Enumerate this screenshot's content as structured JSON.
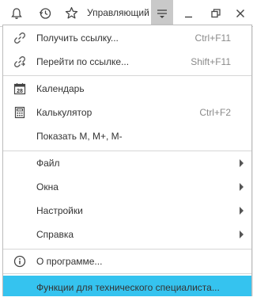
{
  "toolbar": {
    "user_label": "Управляющий",
    "icons": [
      "bell-icon",
      "history-icon",
      "star-icon",
      "menu-icon",
      "minimize-icon",
      "restore-icon",
      "close-icon"
    ]
  },
  "menu": {
    "items": [
      {
        "label": "Получить ссылку...",
        "shortcut": "Ctrl+F11",
        "icon": "link-icon"
      },
      {
        "label": "Перейти по ссылке...",
        "shortcut": "Shift+F11",
        "icon": "follow-link-icon"
      },
      {
        "label": "Календарь",
        "shortcut": "",
        "icon": "calendar-icon",
        "icon_text": "28"
      },
      {
        "label": "Калькулятор",
        "shortcut": "Ctrl+F2",
        "icon": "calculator-icon"
      },
      {
        "label": "Показать М, М+, М-",
        "shortcut": "",
        "icon": ""
      },
      {
        "label": "Файл",
        "submenu": true
      },
      {
        "label": "Окна",
        "submenu": true
      },
      {
        "label": "Настройки",
        "submenu": true
      },
      {
        "label": "Справка",
        "submenu": true
      },
      {
        "label": "О программе...",
        "shortcut": "",
        "icon": "info-icon"
      },
      {
        "label": "Функции для технического специалиста...",
        "shortcut": "",
        "icon": "",
        "highlighted": true
      }
    ]
  },
  "colors": {
    "highlight": "#35c3ef",
    "active_button": "#c9c9c9"
  }
}
